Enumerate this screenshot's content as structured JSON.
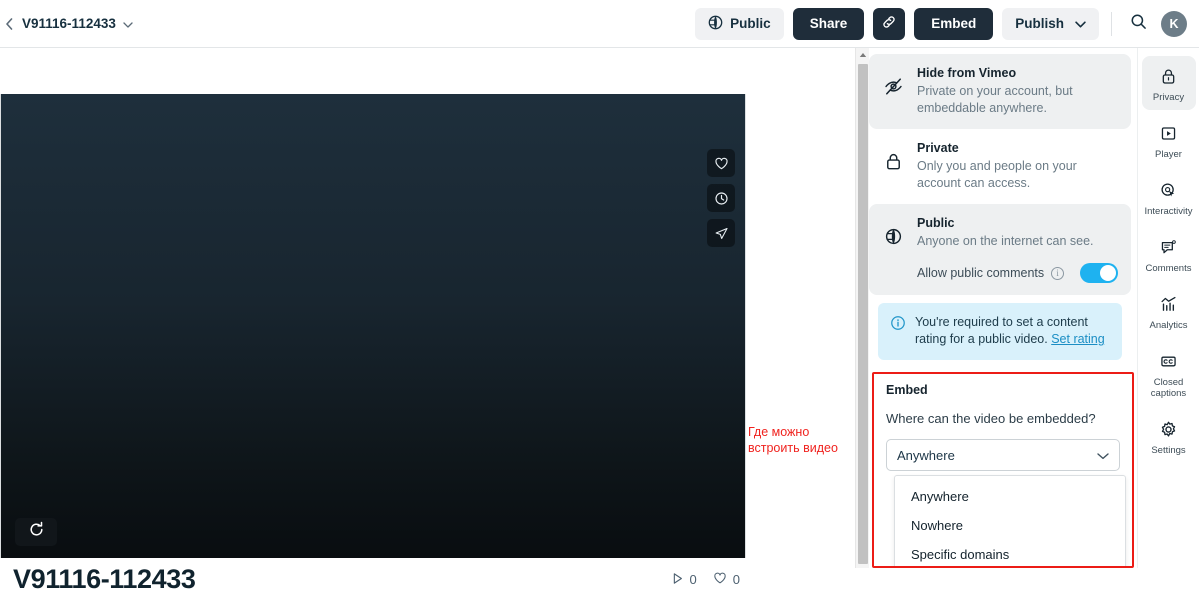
{
  "topbar": {
    "back_icon": "chevron-left-icon",
    "video_title": "V91116-112433",
    "title_chevron": "chevron-down-icon",
    "privacy_badge": {
      "label": "Public",
      "icon": "globe-privacy-icon"
    },
    "share_label": "Share",
    "link_icon": "link-icon",
    "embed_label": "Embed",
    "publish_label": "Publish",
    "publish_chevron": "chevron-down-icon",
    "search_icon": "search-icon",
    "avatar_initial": "K"
  },
  "player": {
    "side_icons": [
      "heart-icon",
      "clock-watch-later-icon",
      "send-share-icon"
    ],
    "replay_icon": "replay-icon",
    "heading": "V91116-112433",
    "stats": [
      {
        "icon": "play-icon",
        "value": "0"
      },
      {
        "icon": "heart-icon",
        "value": "0"
      }
    ]
  },
  "annotation": {
    "text": "Где можно встроить видео",
    "color": "#f0231f"
  },
  "scrollbar": {
    "up_icon": "scroll-up-arrow-icon"
  },
  "panel": {
    "privacy_options": [
      {
        "id": "hide-from-vimeo",
        "icon": "eye-slash-icon",
        "title": "Hide from Vimeo",
        "desc": "Private on your account, but embeddable anywhere.",
        "selected": true
      },
      {
        "id": "private",
        "icon": "lock-icon",
        "title": "Private",
        "desc": "Only you and people on your account can access.",
        "selected": false
      },
      {
        "id": "public",
        "icon": "globe-privacy-icon",
        "title": "Public",
        "desc": "Anyone on the internet can see.",
        "selected": true
      }
    ],
    "allow_comments": {
      "label": "Allow public comments",
      "info_icon": "info-icon",
      "toggle_on": true,
      "toggle_color": "#1eb2f0"
    },
    "rating_notice": {
      "icon": "info-circle-icon",
      "text": "You're required to set a content rating for a public video.",
      "link": "Set rating",
      "bg": "#d9f1fb"
    }
  },
  "embed": {
    "title": "Embed",
    "question": "Where can the video be embedded?",
    "selected_value": "Anywhere",
    "select_chevron": "chevron-down-icon",
    "options": [
      "Anywhere",
      "Nowhere",
      "Specific domains"
    ],
    "highlight_color": "#ec1c16"
  },
  "rail": {
    "items": [
      {
        "icon": "lock-privacy-icon",
        "label": "Privacy",
        "active": true
      },
      {
        "icon": "player-play-icon",
        "label": "Player",
        "active": false
      },
      {
        "icon": "interactivity-target-icon",
        "label": "Interactivity",
        "active": false
      },
      {
        "icon": "comments-icon",
        "label": "Comments",
        "active": false
      },
      {
        "icon": "analytics-chart-icon",
        "label": "Analytics",
        "active": false
      },
      {
        "icon": "closed-captions-icon",
        "label": "Closed captions",
        "active": false
      },
      {
        "icon": "settings-gear-icon",
        "label": "Settings",
        "active": false
      }
    ]
  }
}
